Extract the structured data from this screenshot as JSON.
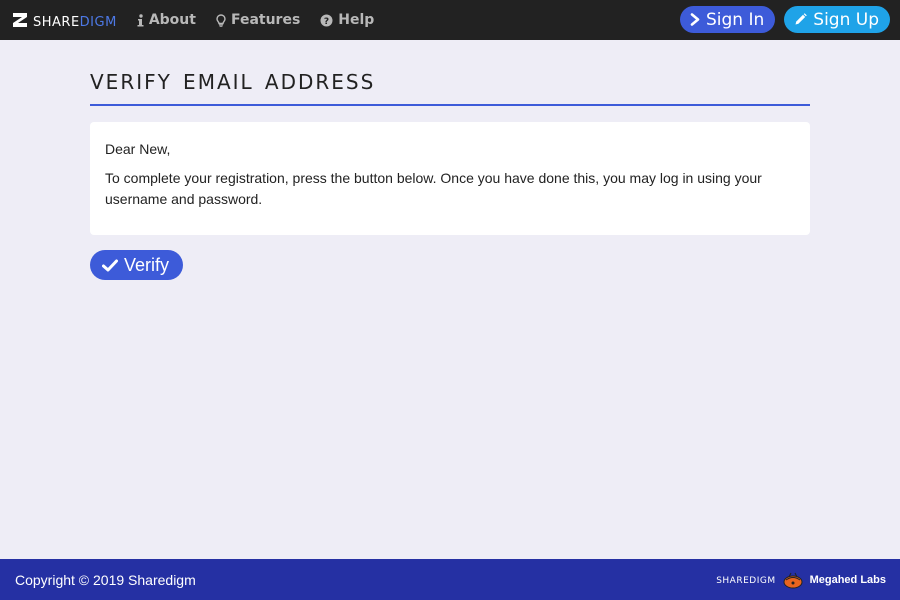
{
  "nav": {
    "brand_share": "share",
    "brand_digm": "digm",
    "links": [
      {
        "icon": "info-icon",
        "label": "About"
      },
      {
        "icon": "lightbulb-icon",
        "label": "Features"
      },
      {
        "icon": "question-circle-icon",
        "label": "Help"
      }
    ],
    "sign_in_label": "Sign In",
    "sign_up_label": "Sign Up"
  },
  "main": {
    "title": "Verify Email Address",
    "greeting": "Dear New,",
    "message": "To complete your registration, press the button below. Once you have done this, you may log in using your username and password.",
    "verify_label": "Verify"
  },
  "footer": {
    "copyright": "Copyright © 2019 Sharedigm",
    "brand": "sharedigm",
    "lab": "Megahed Labs"
  },
  "colors": {
    "navbar_bg": "#222222",
    "accent": "#3d5bd9",
    "signup": "#1fa3e8",
    "footer_bg": "#2530a3",
    "page_bg": "#eeedf6"
  }
}
